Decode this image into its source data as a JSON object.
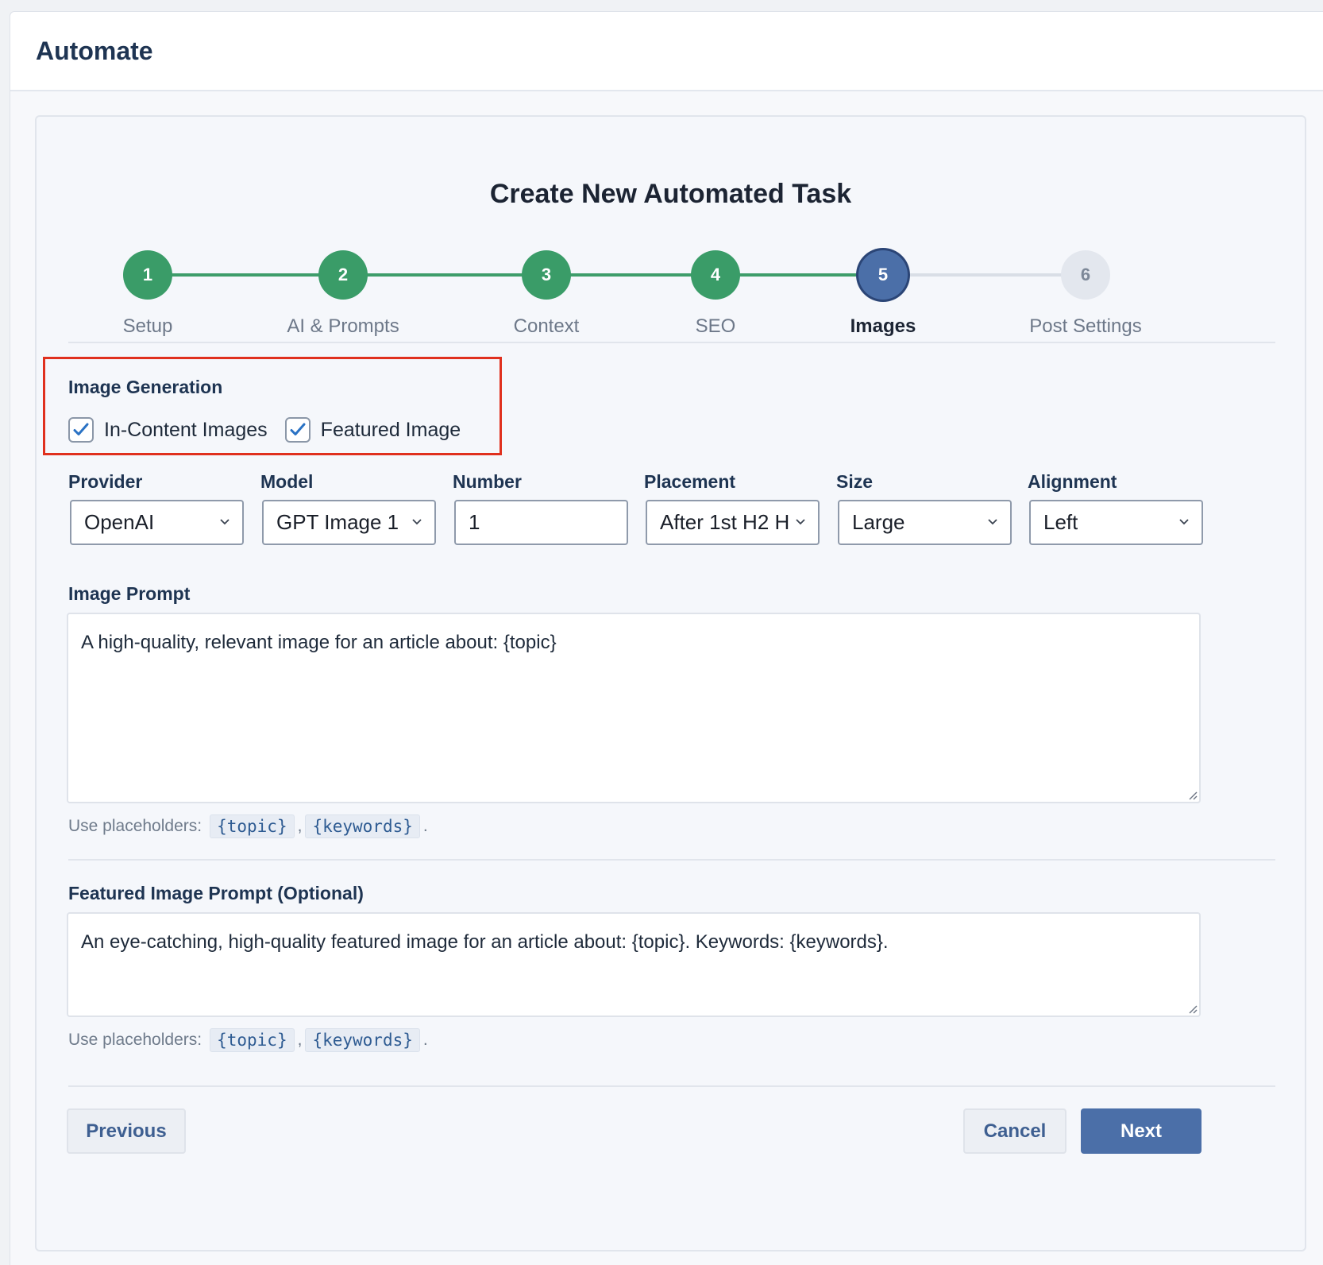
{
  "app": {
    "title": "Automate"
  },
  "wizard": {
    "title": "Create New Automated Task",
    "steps": [
      {
        "number": "1",
        "label": "Setup",
        "state": "done"
      },
      {
        "number": "2",
        "label": "AI & Prompts",
        "state": "done"
      },
      {
        "number": "3",
        "label": "Context",
        "state": "done"
      },
      {
        "number": "4",
        "label": "SEO",
        "state": "done"
      },
      {
        "number": "5",
        "label": "Images",
        "state": "active"
      },
      {
        "number": "6",
        "label": "Post Settings",
        "state": "todo"
      }
    ]
  },
  "image_generation": {
    "label": "Image Generation",
    "in_content": {
      "label": "In-Content Images",
      "checked": true
    },
    "featured": {
      "label": "Featured Image",
      "checked": true
    }
  },
  "fields": {
    "provider": {
      "label": "Provider",
      "value": "OpenAI"
    },
    "model": {
      "label": "Model",
      "value": "GPT Image 1"
    },
    "number": {
      "label": "Number",
      "value": "1"
    },
    "placement": {
      "label": "Placement",
      "value": "After 1st H2 H"
    },
    "size": {
      "label": "Size",
      "value": "Large"
    },
    "alignment": {
      "label": "Alignment",
      "value": "Left"
    }
  },
  "image_prompt": {
    "label": "Image Prompt",
    "value": "A high-quality, relevant image for an article about: {topic}",
    "hint_prefix": "Use placeholders:",
    "placeholders": [
      "{topic}",
      "{keywords}"
    ]
  },
  "featured_prompt": {
    "label": "Featured Image Prompt (Optional)",
    "value": "An eye-catching, high-quality featured image for an article about: {topic}. Keywords: {keywords}.",
    "hint_prefix": "Use placeholders:",
    "placeholders": [
      "{topic}",
      "{keywords}"
    ]
  },
  "actions": {
    "previous": "Previous",
    "cancel": "Cancel",
    "next": "Next"
  },
  "colors": {
    "done": "#3a9c68",
    "active": "#4b6fa8",
    "highlight": "#e0301e"
  }
}
